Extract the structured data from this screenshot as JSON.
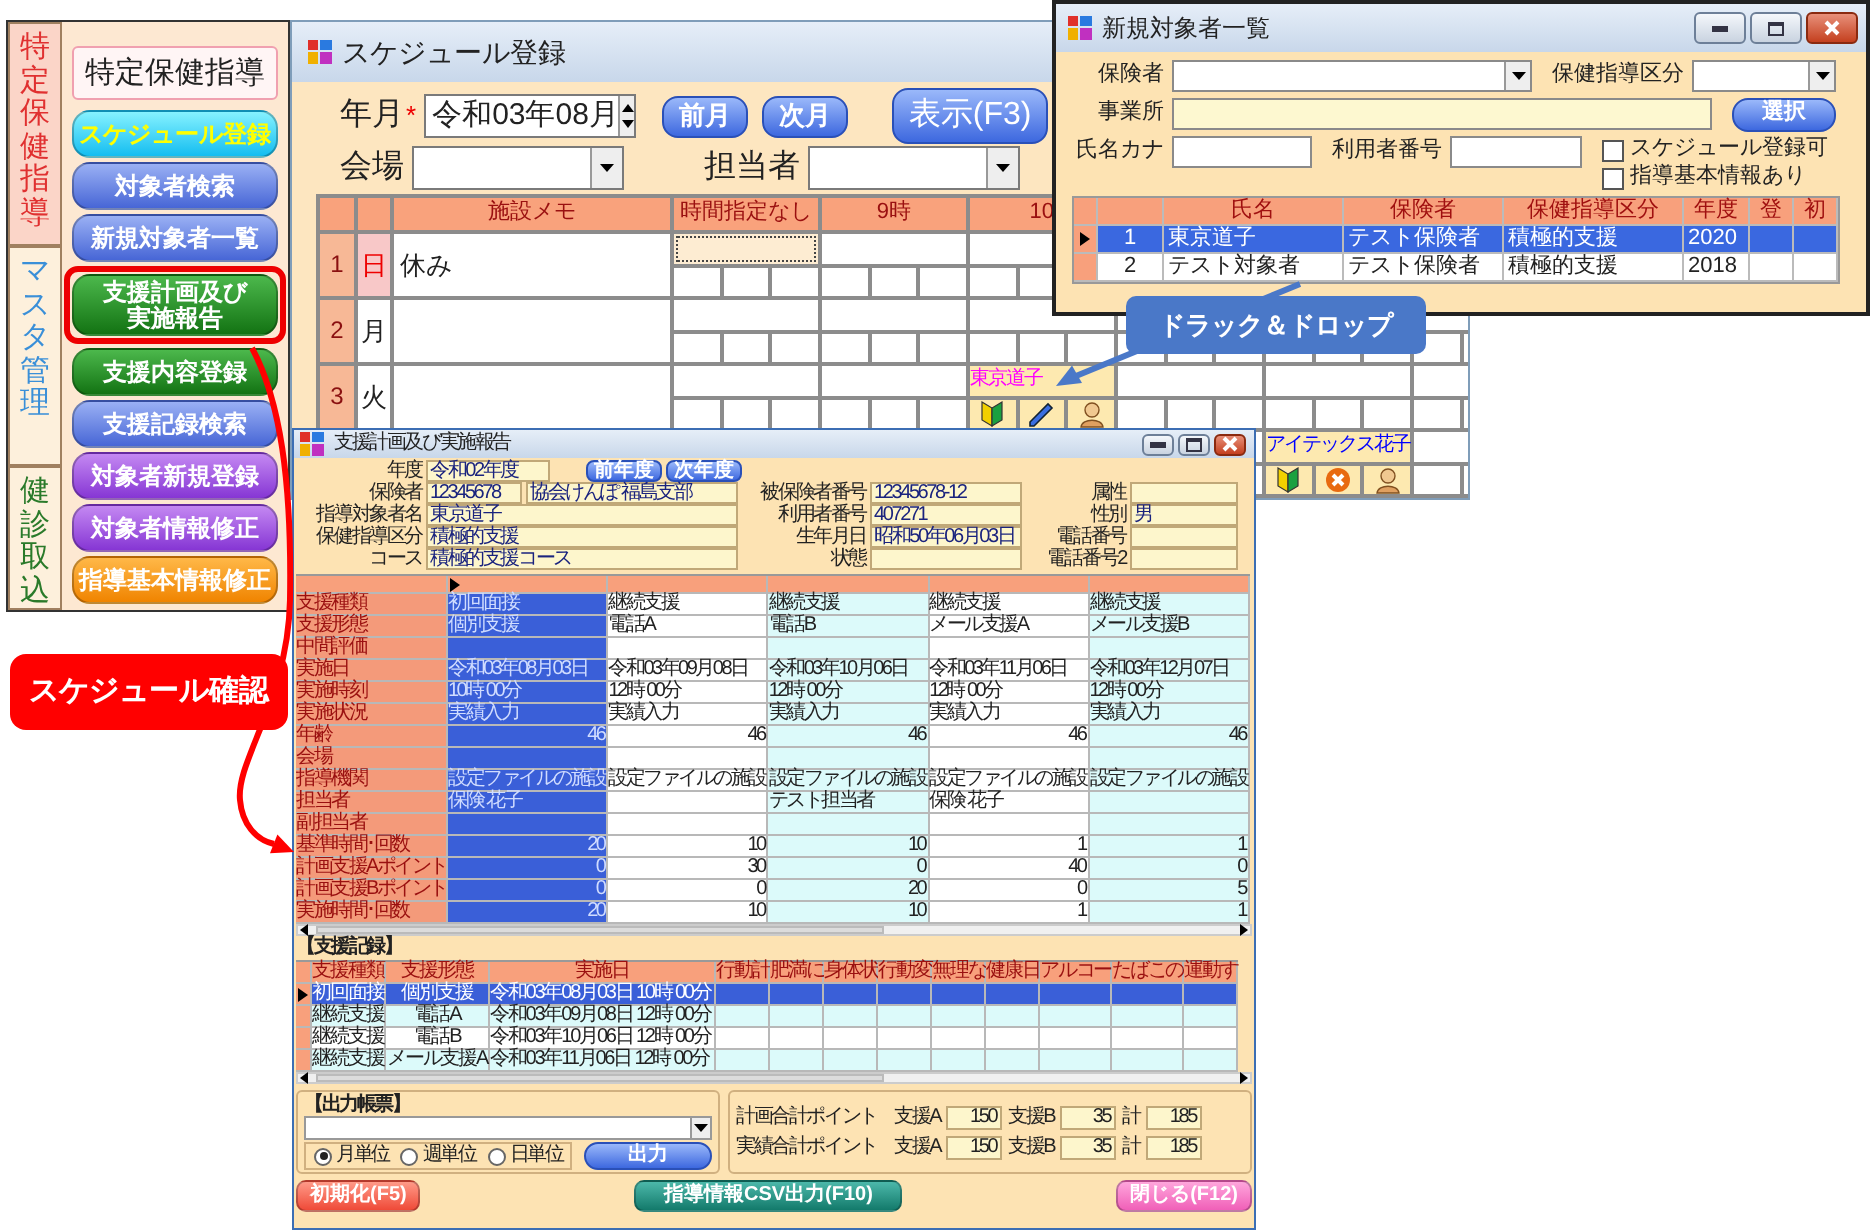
{
  "sidebar": {
    "tabs": [
      {
        "label": "特定保健指導",
        "selected": true,
        "color": "#e03030"
      },
      {
        "label": "マスタ管理",
        "selected": false,
        "color": "#3a8fd8"
      },
      {
        "label": "健診取込",
        "selected": false,
        "color": "#2a7a2a"
      }
    ],
    "title": "特定保健指導",
    "buttons": [
      {
        "label": "スケジュール登録",
        "kind": "cyan",
        "highlighted": false
      },
      {
        "label": "対象者検索",
        "kind": "blue",
        "highlighted": false
      },
      {
        "label": "新規対象者一覧",
        "kind": "blue",
        "highlighted": false
      },
      {
        "label": "支援計画及び実施報告",
        "kind": "green",
        "highlighted": true
      },
      {
        "label": "支援内容登録",
        "kind": "green",
        "highlighted": false
      },
      {
        "label": "支援記録検索",
        "kind": "blue",
        "highlighted": false
      },
      {
        "label": "対象者新規登録",
        "kind": "purple",
        "highlighted": false
      },
      {
        "label": "対象者情報修正",
        "kind": "purple",
        "highlighted": false
      },
      {
        "label": "指導基本情報修正",
        "kind": "orange",
        "highlighted": false
      }
    ]
  },
  "schedule": {
    "title": "スケジュール登録",
    "month_label": "年月",
    "required_mark": "*",
    "month": "令和03年08月",
    "prev_button": "前月",
    "next_button": "次月",
    "show_button": "表示(F3)",
    "venue_label": "会場",
    "staff_label": "担当者",
    "columns": {
      "memo": "施設メモ",
      "slots": [
        "時間指定なし",
        "9時",
        "10"
      ]
    },
    "rows": [
      {
        "num": "1",
        "day": "日",
        "holiday": true,
        "memo": "休み",
        "slots": {
          "slot_1": {
            "selected": true
          },
          "slot_2": {
            "selected": false
          },
          "slot_3": {
            "selected": false
          }
        }
      },
      {
        "num": "2",
        "day": "月",
        "holiday": false,
        "slots": {
          "slot_1": {
            "selected": false
          },
          "slot_2": {
            "selected": false
          },
          "slot_3": {
            "selected": false
          }
        }
      },
      {
        "num": "3",
        "day": "火",
        "holiday": false,
        "slots": {
          "slot_1": {
            "selected": false
          },
          "slot_2": {
            "selected": false
          },
          "slot_3": {
            "selected": false,
            "booking": {
              "name": "東京道子",
              "color": "#ff00ff",
              "icons": [
                {
                  "kind": "beginner"
                },
                {
                  "kind": "pencil"
                },
                {
                  "kind": "person"
                }
              ]
            }
          },
          "slot_4": {
            "selected": false
          },
          "slot_5": {
            "selected": false
          },
          "slot_6": {
            "selected": false
          }
        }
      },
      {
        "slots": {
          "slot_5": {
            "selected": false,
            "booking": {
              "name": "アイテックス花子",
              "color": "#0000ff",
              "icons": [
                {
                  "kind": "beginner"
                },
                {
                  "kind": "cancel"
                },
                {
                  "kind": "person"
                }
              ]
            }
          },
          "slot_6": {
            "selected": false
          }
        }
      }
    ]
  },
  "new_subjects": {
    "title": "新規対象者一覧",
    "insurer_label": "保険者",
    "category_label": "保健指導区分",
    "office_label": "事業所",
    "select_button": "選択",
    "kana_label": "氏名カナ",
    "user_no_label": "利用者番号",
    "checkboxes": [
      {
        "label": "スケジュール登録可",
        "checked": false
      },
      {
        "label": "指導基本情報あり",
        "checked": false
      }
    ],
    "columns": [
      "氏名",
      "保険者",
      "保健指導区分",
      "年度",
      "登",
      "初"
    ],
    "rows": [
      {
        "num": "1",
        "name": "東京道子",
        "insurer": "テスト保険者",
        "category": "積極的支援",
        "year": "2020",
        "selected": true
      },
      {
        "num": "2",
        "name": "テスト対象者",
        "insurer": "テスト保険者",
        "category": "積極的支援",
        "year": "2018",
        "selected": false
      }
    ]
  },
  "plan": {
    "title": "支援計画及び実施報告",
    "year": {
      "label": "年度",
      "value": "令和02年度"
    },
    "year_buttons": [
      "前年度",
      "次年度"
    ],
    "info": [
      [
        {
          "label": "保険者",
          "values": [
            "12345678",
            "協会けんぽ 福島支部"
          ]
        },
        {
          "label": "被保険者番号",
          "values": [
            "12345678-12"
          ]
        },
        {
          "label": "属性"
        }
      ],
      [
        {
          "label": "指導対象者名",
          "values": [
            "東京道子"
          ]
        },
        {
          "label": "利用者番号",
          "values": [
            "407271"
          ]
        },
        {
          "label": "性別",
          "values": [
            "男"
          ]
        }
      ],
      [
        {
          "label": "保健指導区分",
          "values": [
            "積極的支援"
          ]
        },
        {
          "label": "生年月日",
          "values": [
            "昭和50年06月03日"
          ]
        },
        {
          "label": "電話番号"
        }
      ],
      [
        {
          "label": "コース",
          "values": [
            "積極的支援コース"
          ]
        },
        {
          "label": "状態"
        },
        {
          "label": "電話番号2"
        }
      ]
    ],
    "grid": {
      "columns": [
        {
          "selected": true
        },
        {
          "selected": false
        },
        {
          "selected": false
        },
        {
          "selected": false
        },
        {
          "selected": false
        }
      ],
      "rows": [
        {
          "label": "支援種類",
          "kind": "text",
          "cells": [
            "初回面接",
            "継続支援",
            "継続支援",
            "継続支援",
            "継続支援"
          ]
        },
        {
          "label": "支援形態",
          "kind": "text",
          "cells": [
            "個別支援",
            "電話A",
            "電話B",
            "メール支援A",
            "メール支援B"
          ]
        },
        {
          "label": "中間評価",
          "kind": "text",
          "cells": [
            null,
            null,
            null,
            null,
            null
          ]
        },
        {
          "label": "実施日",
          "kind": "text",
          "cells": [
            "令和03年08月03日",
            "令和03年09月08日",
            "令和03年10月06日",
            "令和03年11月06日",
            "令和03年12月07日"
          ]
        },
        {
          "label": "実施時刻",
          "kind": "text",
          "cells": [
            "10時 00分",
            "12時 00分",
            "12時 00分",
            "12時 00分",
            "12時 00分"
          ]
        },
        {
          "label": "実施状況",
          "kind": "text",
          "cells": [
            "実績入力",
            "実績入力",
            "実績入力",
            "実績入力",
            "実績入力"
          ]
        },
        {
          "label": "年齢",
          "kind": "number",
          "cells": [
            "46",
            "46",
            "46",
            "46",
            "46"
          ]
        },
        {
          "label": "会場",
          "kind": "text",
          "cells": [
            null,
            null,
            null,
            null,
            null
          ]
        },
        {
          "label": "指導機関",
          "kind": "text",
          "cells": [
            "設定ファイルの施設",
            "設定ファイルの施設",
            "設定ファイルの施設",
            "設定ファイルの施設",
            "設定ファイルの施設"
          ]
        },
        {
          "label": "担当者",
          "kind": "text",
          "cells": [
            "保険 花子",
            null,
            "テスト担当者",
            "保険 花子",
            null
          ]
        },
        {
          "label": "副担当者",
          "kind": "text",
          "cells": [
            null,
            null,
            null,
            null,
            null
          ]
        },
        {
          "label": "基準時間･回数",
          "kind": "number",
          "cells": [
            "20",
            "10",
            "10",
            "1",
            "1"
          ]
        },
        {
          "label": "計画支援Aポイント",
          "kind": "number",
          "cells": [
            "0",
            "30",
            "0",
            "40",
            "0"
          ]
        },
        {
          "label": "計画支援Bポイント",
          "kind": "number",
          "cells": [
            "0",
            "0",
            "20",
            "0",
            "5"
          ]
        },
        {
          "label": "実施時間･回数",
          "kind": "number",
          "cells": [
            "20",
            "10",
            "10",
            "1",
            "1"
          ]
        }
      ]
    },
    "records": {
      "label": "【支援記録】",
      "columns": [
        "支援種類",
        "支援形態",
        "実施日",
        "行動計",
        "肥満に",
        "身体状",
        "行動変",
        "無理な",
        "健康日",
        "アルコー",
        "たばこの",
        "運動す"
      ],
      "rows": [
        {
          "selected": true,
          "cells": [
            "初回面接",
            "個別支援",
            "令和03年08月03日 10時 00分"
          ]
        },
        {
          "selected": false,
          "cells": [
            "継続支援",
            "電話A",
            "令和03年09月08日 12時 00分"
          ]
        },
        {
          "selected": false,
          "cells": [
            "継続支援",
            "電話B",
            "令和03年10月06日 12時 00分"
          ]
        },
        {
          "selected": false,
          "cells": [
            "継続支援",
            "メール支援A",
            "令和03年11月06日 12時 00分"
          ]
        }
      ]
    },
    "output": {
      "label": "【出力帳票】",
      "units": [
        {
          "label": "月単位",
          "selected": true
        },
        {
          "label": "週単位",
          "selected": false
        },
        {
          "label": "日単位",
          "selected": false
        }
      ],
      "button": "出力"
    },
    "points": [
      {
        "label": "計画合計ポイント",
        "a_label": "支援A",
        "a": "150",
        "b_label": "支援B",
        "b": "35",
        "total_label": "計",
        "total": "185"
      },
      {
        "label": "実績合計ポイント",
        "a_label": "支援A",
        "a": "150",
        "b_label": "支援B",
        "b": "35",
        "total_label": "計",
        "total": "185"
      }
    ],
    "footer": [
      {
        "label": "初期化(F5)",
        "kind": "reset"
      },
      {
        "label": "指導情報CSV出力(F10)",
        "kind": "csv"
      },
      {
        "label": "閉じる(F12)",
        "kind": "close"
      }
    ]
  },
  "annotations": [
    {
      "kind": "red",
      "label": "スケジュール確認"
    },
    {
      "kind": "blue",
      "label": "ドラック＆ドロップ"
    }
  ]
}
